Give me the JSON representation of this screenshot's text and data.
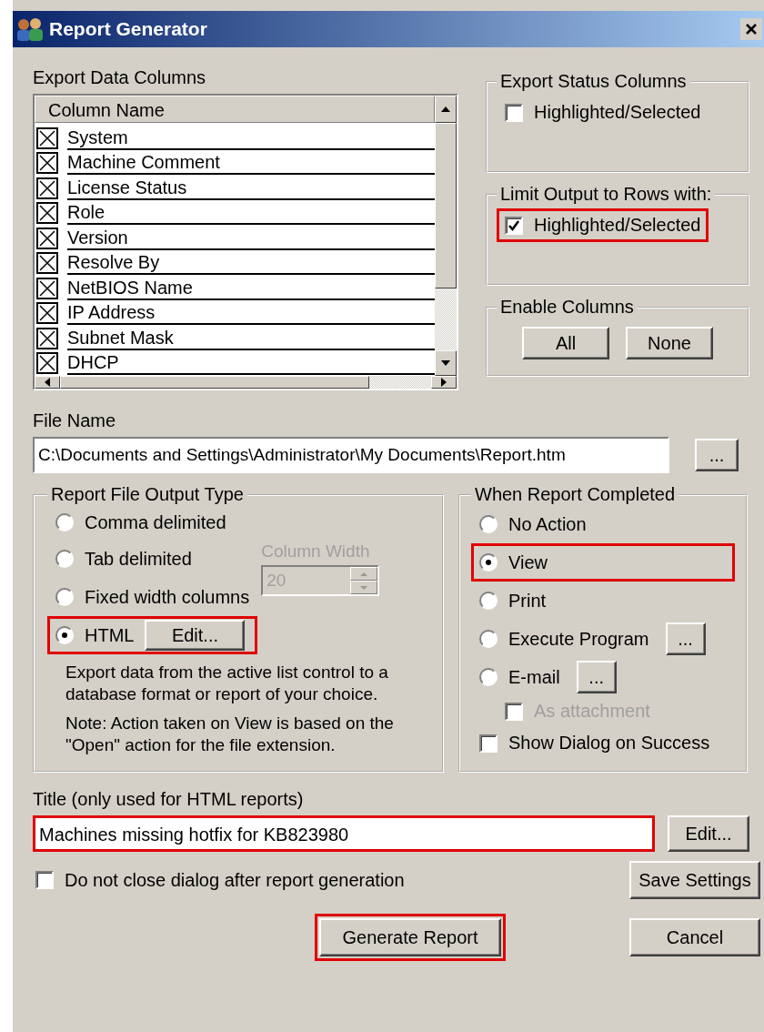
{
  "window": {
    "title": "Report Generator"
  },
  "export_data_columns": {
    "label": "Export Data Columns",
    "header": "Column Name",
    "items": [
      {
        "label": "System",
        "checked": true
      },
      {
        "label": "Machine Comment",
        "checked": true
      },
      {
        "label": "License Status",
        "checked": true
      },
      {
        "label": "Role",
        "checked": true
      },
      {
        "label": "Version",
        "checked": true
      },
      {
        "label": "Resolve By",
        "checked": true
      },
      {
        "label": "NetBIOS Name",
        "checked": true
      },
      {
        "label": "IP Address",
        "checked": true
      },
      {
        "label": "Subnet Mask",
        "checked": true
      },
      {
        "label": "DHCP",
        "checked": true
      }
    ]
  },
  "export_status_columns": {
    "label": "Export Status Columns",
    "option": {
      "label": "Highlighted/Selected",
      "checked": false
    }
  },
  "limit_output": {
    "label": "Limit Output to Rows with:",
    "option": {
      "label": "Highlighted/Selected",
      "checked": true,
      "highlighted": true
    }
  },
  "enable_columns": {
    "label": "Enable Columns",
    "buttons": [
      "All",
      "None"
    ]
  },
  "file_name": {
    "label": "File Name",
    "value": "C:\\Documents and Settings\\Administrator\\My Documents\\Report.htm",
    "browse": "..."
  },
  "output_type": {
    "label": "Report File Output Type",
    "options": [
      {
        "label": "Comma delimited",
        "selected": false,
        "highlighted": false
      },
      {
        "label": "Tab delimited",
        "selected": false,
        "highlighted": false
      },
      {
        "label": "Fixed width columns",
        "selected": false,
        "highlighted": false
      },
      {
        "label": "HTML",
        "selected": true,
        "highlighted": true
      }
    ],
    "column_width": {
      "label": "Column Width",
      "value": "20",
      "disabled": true
    },
    "edit_button": "Edit...",
    "description": "Export data from the active list control to a database format or report of your choice.",
    "note": "Note: Action taken on View is based on the \"Open\" action for the file extension."
  },
  "when_completed": {
    "label": "When Report Completed",
    "options": [
      {
        "label": "No Action",
        "selected": false,
        "highlighted": false
      },
      {
        "label": "View",
        "selected": true,
        "highlighted": true
      },
      {
        "label": "Print",
        "selected": false,
        "highlighted": false
      },
      {
        "label": "Execute Program",
        "selected": false,
        "highlighted": false,
        "button": "..."
      },
      {
        "label": "E-mail",
        "selected": false,
        "highlighted": false,
        "button": "..."
      }
    ],
    "attachment": {
      "label": "As attachment",
      "checked": false,
      "disabled": true
    },
    "show_dialog": {
      "label": "Show Dialog on Success",
      "checked": false
    }
  },
  "title_field": {
    "label": "Title (only used for HTML reports)",
    "value": "Machines missing hotfix for KB823980",
    "highlighted": true,
    "edit_button": "Edit..."
  },
  "do_not_close": {
    "label": "Do not close dialog after report generation",
    "checked": false
  },
  "save_button": {
    "label": "Save Settings"
  },
  "generate_button": {
    "label": "Generate Report",
    "highlighted": true
  },
  "cancel_button": {
    "label": "Cancel"
  }
}
